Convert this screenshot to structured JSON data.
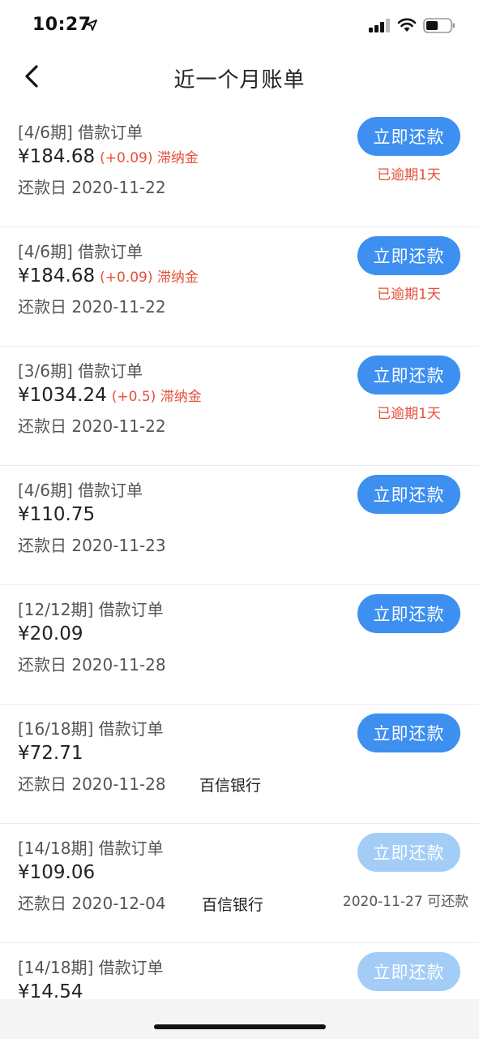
{
  "status_bar": {
    "time": "10:27",
    "icons": [
      "location-arrow-icon",
      "signal-icon",
      "wifi-icon",
      "battery-icon"
    ]
  },
  "nav": {
    "title": "近一个月账单",
    "back_icon": "chevron-left-icon"
  },
  "colors": {
    "primary_button": "#3d8ff0",
    "disabled_button": "#a3cdf7",
    "overdue_red": "#e5503a"
  },
  "bills": [
    {
      "period": "[4/6期] 借款订单",
      "amount": "¥184.68",
      "late_fee": "(+0.09) 滞纳金",
      "due_date": "还款日 2020-11-22",
      "bank": "",
      "button": "立即还款",
      "status": "已逾期1天"
    },
    {
      "period": "[4/6期] 借款订单",
      "amount": "¥184.68",
      "late_fee": "(+0.09) 滞纳金",
      "due_date": "还款日 2020-11-22",
      "bank": "",
      "button": "立即还款",
      "status": "已逾期1天"
    },
    {
      "period": "[3/6期] 借款订单",
      "amount": "¥1034.24",
      "late_fee": "(+0.5) 滞纳金",
      "due_date": "还款日 2020-11-22",
      "bank": "",
      "button": "立即还款",
      "status": "已逾期1天"
    },
    {
      "period": "[4/6期] 借款订单",
      "amount": "¥110.75",
      "late_fee": "",
      "due_date": "还款日 2020-11-23",
      "bank": "",
      "button": "立即还款",
      "status": ""
    },
    {
      "period": "[12/12期] 借款订单",
      "amount": "¥20.09",
      "late_fee": "",
      "due_date": "还款日 2020-11-28",
      "bank": "",
      "button": "立即还款",
      "status": ""
    },
    {
      "period": "[16/18期] 借款订单",
      "amount": "¥72.71",
      "late_fee": "",
      "due_date": "还款日 2020-11-28",
      "bank": "百信银行",
      "button": "立即还款",
      "status": ""
    },
    {
      "period": "[14/18期] 借款订单",
      "amount": "¥109.06",
      "late_fee": "",
      "due_date": "还款日 2020-12-04",
      "bank": "百信银行",
      "button": "立即还款",
      "status": "2020-11-27 可还款"
    },
    {
      "period": "[14/18期] 借款订单",
      "amount": "¥14.54",
      "late_fee": "",
      "due_date": "",
      "bank": "",
      "button": "立即还款",
      "status": ""
    }
  ]
}
